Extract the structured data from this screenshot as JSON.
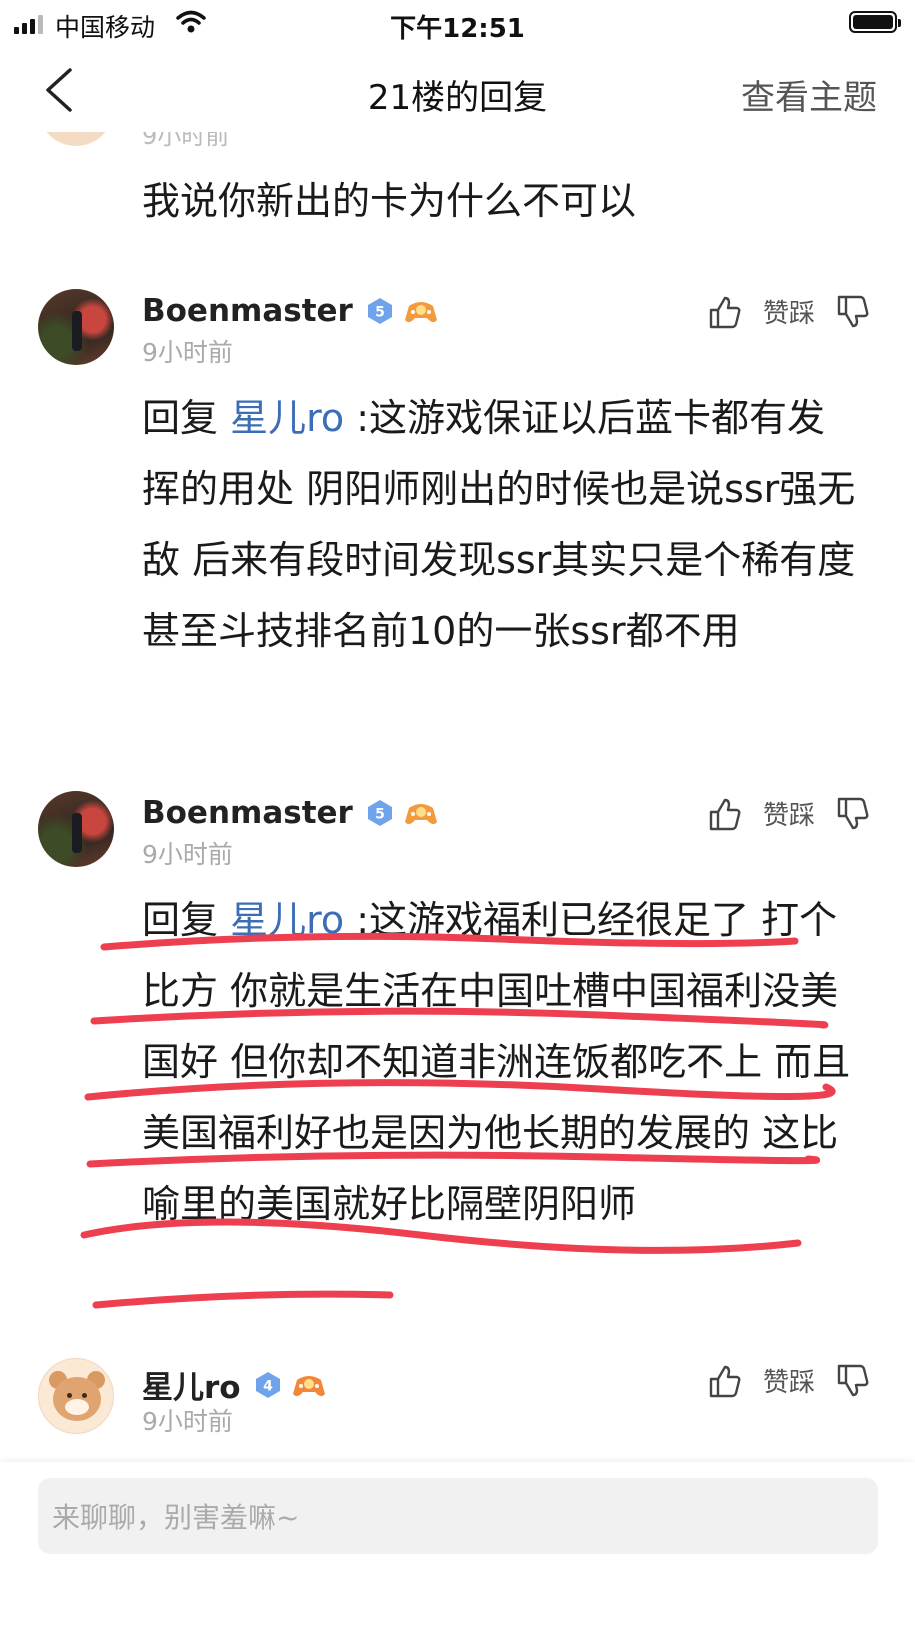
{
  "status_bar": {
    "carrier": "中国移动",
    "time": "下午12:51"
  },
  "nav": {
    "title": "21楼的回复",
    "right_link": "查看主题"
  },
  "partial_reply": {
    "time": "9小时前",
    "text": "我说你新出的卡为什么不可以"
  },
  "replies": [
    {
      "name": "Boenmaster",
      "level": "5",
      "time": "9小时前",
      "vote_label": "赞踩",
      "reply_prefix": "回复",
      "mention": "星儿ro",
      "text": " :这游戏保证以后蓝卡都有发挥的用处 阴阳师刚出的时候也是说ssr强无敌 后来有段时间发现ssr其实只是个稀有度 甚至斗技排名前10的一张ssr都不用"
    },
    {
      "name": "Boenmaster",
      "level": "5",
      "time": "9小时前",
      "vote_label": "赞踩",
      "reply_prefix": "回复",
      "mention": "星儿ro",
      "text": " :这游戏福利已经很足了 打个比方 你就是生活在中国吐槽中国福利没美国好 但你却不知道非洲连饭都吃不上 而且美国福利好也是因为他长期的发展的 这比喻里的美国就好比隔壁阴阳师"
    },
    {
      "name": "星儿ro",
      "level": "4",
      "time": "9小时前",
      "vote_label": "赞踩"
    }
  ],
  "input": {
    "placeholder": "来聊聊，别害羞嘛~"
  },
  "colors": {
    "mention": "#3d6db5",
    "badge": "#6fa3ec",
    "underline": "#ee3f50"
  },
  "icons": [
    "cellular-signal-icon",
    "wifi-icon",
    "battery-icon",
    "back-chevron-icon",
    "level-badge-icon",
    "game-badge-icon",
    "thumbs-up-icon",
    "thumbs-down-icon"
  ]
}
